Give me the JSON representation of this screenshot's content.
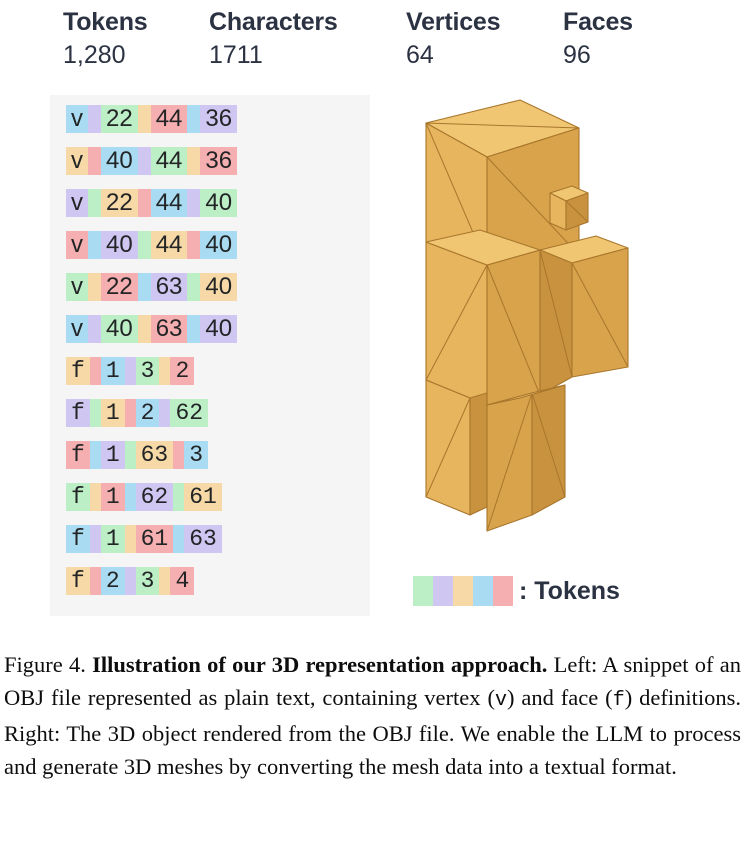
{
  "stats": [
    {
      "id": "tokens",
      "label": "Tokens",
      "value": "1,280"
    },
    {
      "id": "characters",
      "label": "Characters",
      "value": "1711"
    },
    {
      "id": "vertices",
      "label": "Vertices",
      "value": "64"
    },
    {
      "id": "faces",
      "label": "Faces",
      "value": "96"
    }
  ],
  "obj_snippet": {
    "lines": [
      {
        "type": "v",
        "text": "v 22 44 36",
        "tokens": [
          {
            "t": "v",
            "c": "#a9dcf2"
          },
          {
            "t": " ",
            "c": "#cfc6f2"
          },
          {
            "t": "22",
            "c": "#bdefc6"
          },
          {
            "t": " ",
            "c": "#f6d9a6"
          },
          {
            "t": "44",
            "c": "#f6afb0"
          },
          {
            "t": " ",
            "c": "#a9dcf2"
          },
          {
            "t": "36",
            "c": "#cfc6f2"
          }
        ]
      },
      {
        "type": "v",
        "text": "v 40 44 36",
        "tokens": [
          {
            "t": "v",
            "c": "#f6d9a6"
          },
          {
            "t": " ",
            "c": "#f6afb0"
          },
          {
            "t": "40",
            "c": "#a9dcf2"
          },
          {
            "t": " ",
            "c": "#cfc6f2"
          },
          {
            "t": "44",
            "c": "#bdefc6"
          },
          {
            "t": " ",
            "c": "#f6d9a6"
          },
          {
            "t": "36",
            "c": "#f6afb0"
          }
        ]
      },
      {
        "type": "v",
        "text": "v 22 44 40",
        "tokens": [
          {
            "t": "v",
            "c": "#cfc6f2"
          },
          {
            "t": " ",
            "c": "#bdefc6"
          },
          {
            "t": "22",
            "c": "#f6d9a6"
          },
          {
            "t": " ",
            "c": "#f6afb0"
          },
          {
            "t": "44",
            "c": "#a9dcf2"
          },
          {
            "t": " ",
            "c": "#cfc6f2"
          },
          {
            "t": "40",
            "c": "#bdefc6"
          }
        ]
      },
      {
        "type": "v",
        "text": "v 40 44 40",
        "tokens": [
          {
            "t": "v",
            "c": "#f6afb0"
          },
          {
            "t": " ",
            "c": "#a9dcf2"
          },
          {
            "t": "40",
            "c": "#cfc6f2"
          },
          {
            "t": " ",
            "c": "#bdefc6"
          },
          {
            "t": "44",
            "c": "#f6d9a6"
          },
          {
            "t": " ",
            "c": "#f6afb0"
          },
          {
            "t": "40",
            "c": "#a9dcf2"
          }
        ]
      },
      {
        "type": "v",
        "text": "v 22 63 40",
        "tokens": [
          {
            "t": "v",
            "c": "#bdefc6"
          },
          {
            "t": " ",
            "c": "#f6d9a6"
          },
          {
            "t": "22",
            "c": "#f6afb0"
          },
          {
            "t": " ",
            "c": "#a9dcf2"
          },
          {
            "t": "63",
            "c": "#cfc6f2"
          },
          {
            "t": " ",
            "c": "#bdefc6"
          },
          {
            "t": "40",
            "c": "#f6d9a6"
          }
        ]
      },
      {
        "type": "v",
        "text": "v 40 63 40",
        "tokens": [
          {
            "t": "v",
            "c": "#a9dcf2"
          },
          {
            "t": " ",
            "c": "#cfc6f2"
          },
          {
            "t": "40",
            "c": "#bdefc6"
          },
          {
            "t": " ",
            "c": "#f6d9a6"
          },
          {
            "t": "63",
            "c": "#f6afb0"
          },
          {
            "t": " ",
            "c": "#a9dcf2"
          },
          {
            "t": "40",
            "c": "#cfc6f2"
          }
        ]
      },
      {
        "type": "f",
        "text": "f 1 3 2",
        "tokens": [
          {
            "t": "f",
            "c": "#f6d9a6"
          },
          {
            "t": " ",
            "c": "#f6afb0"
          },
          {
            "t": "1",
            "c": "#a9dcf2"
          },
          {
            "t": " ",
            "c": "#cfc6f2"
          },
          {
            "t": "3",
            "c": "#bdefc6"
          },
          {
            "t": " ",
            "c": "#f6d9a6"
          },
          {
            "t": "2",
            "c": "#f6afb0"
          }
        ]
      },
      {
        "type": "f",
        "text": "f 1 2 62",
        "tokens": [
          {
            "t": "f",
            "c": "#cfc6f2"
          },
          {
            "t": " ",
            "c": "#bdefc6"
          },
          {
            "t": "1",
            "c": "#f6d9a6"
          },
          {
            "t": " ",
            "c": "#f6afb0"
          },
          {
            "t": "2",
            "c": "#a9dcf2"
          },
          {
            "t": " ",
            "c": "#cfc6f2"
          },
          {
            "t": "62",
            "c": "#bdefc6"
          }
        ]
      },
      {
        "type": "f",
        "text": "f 1 63 3",
        "tokens": [
          {
            "t": "f",
            "c": "#f6afb0"
          },
          {
            "t": " ",
            "c": "#a9dcf2"
          },
          {
            "t": "1",
            "c": "#cfc6f2"
          },
          {
            "t": " ",
            "c": "#bdefc6"
          },
          {
            "t": "63",
            "c": "#f6d9a6"
          },
          {
            "t": " ",
            "c": "#f6afb0"
          },
          {
            "t": "3",
            "c": "#a9dcf2"
          }
        ]
      },
      {
        "type": "f",
        "text": "f 1 62 61",
        "tokens": [
          {
            "t": "f",
            "c": "#bdefc6"
          },
          {
            "t": " ",
            "c": "#f6d9a6"
          },
          {
            "t": "1",
            "c": "#f6afb0"
          },
          {
            "t": " ",
            "c": "#a9dcf2"
          },
          {
            "t": "62",
            "c": "#cfc6f2"
          },
          {
            "t": " ",
            "c": "#bdefc6"
          },
          {
            "t": "61",
            "c": "#f6d9a6"
          }
        ]
      },
      {
        "type": "f",
        "text": "f 1 61 63",
        "tokens": [
          {
            "t": "f",
            "c": "#a9dcf2"
          },
          {
            "t": " ",
            "c": "#cfc6f2"
          },
          {
            "t": "1",
            "c": "#bdefc6"
          },
          {
            "t": " ",
            "c": "#f6d9a6"
          },
          {
            "t": "61",
            "c": "#f6afb0"
          },
          {
            "t": " ",
            "c": "#a9dcf2"
          },
          {
            "t": "63",
            "c": "#cfc6f2"
          }
        ]
      },
      {
        "type": "f",
        "text": "f 2 3 4",
        "tokens": [
          {
            "t": "f",
            "c": "#f6d9a6"
          },
          {
            "t": " ",
            "c": "#f6afb0"
          },
          {
            "t": "2",
            "c": "#a9dcf2"
          },
          {
            "t": " ",
            "c": "#cfc6f2"
          },
          {
            "t": "3",
            "c": "#bdefc6"
          },
          {
            "t": " ",
            "c": "#f6d9a6"
          },
          {
            "t": "4",
            "c": "#f6afb0"
          }
        ]
      }
    ]
  },
  "render": {
    "alt": "low-poly blocky humanoid 3D mesh rendered in amber/gold with visible triangle edges",
    "fill_light": "#f0c673",
    "fill_mid": "#e6b55e",
    "fill_dark": "#d9a34b",
    "fill_darker": "#c9923f",
    "edge": "#a8762c"
  },
  "legend": {
    "label": ": Tokens",
    "colors": [
      "#bdefc6",
      "#cfc6f2",
      "#f6d9a6",
      "#a9dcf2",
      "#f6afb0"
    ]
  },
  "caption": {
    "figure_number": "Figure 4.",
    "title": "Illustration of our 3D representation approach.",
    "body_1": " Left: A snippet of an OBJ file represented as plain text, containing vertex (",
    "mono_v": "v",
    "body_2": ") and face (",
    "mono_f": "f",
    "body_3": ") definitions.  Right: The 3D object rendered from the OBJ file. We enable the LLM to process and generate 3D meshes by converting the mesh data into a textual format."
  }
}
